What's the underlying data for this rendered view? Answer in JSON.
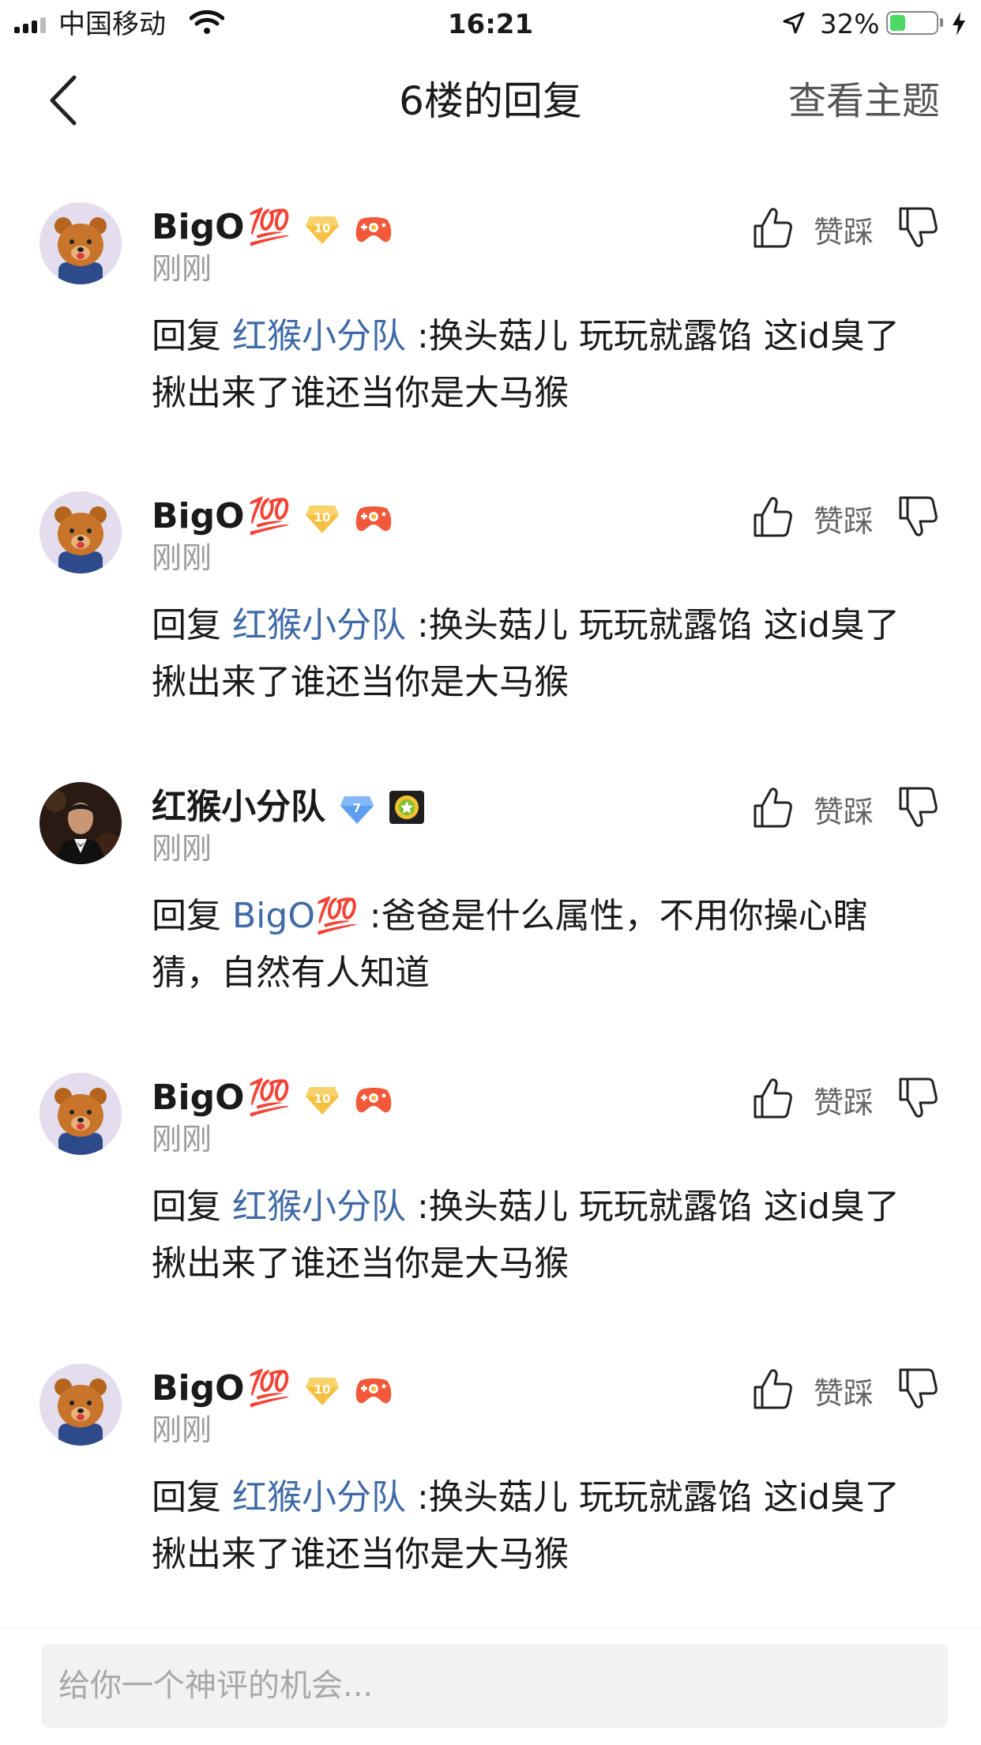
{
  "status_bar": {
    "carrier": "中国移动",
    "time": "16:21",
    "battery_percent": "32%",
    "battery_level": 0.32,
    "battery_color": "#4cd964"
  },
  "nav": {
    "title": "6楼的回复",
    "right_action": "查看主题",
    "back_icon": "chevron-left-icon"
  },
  "colors": {
    "mention": "#3f6aa6",
    "timestamp": "#9b9b9b"
  },
  "replies": [
    {
      "author": "BigO",
      "author_emoji": "💯",
      "level_badge": "10",
      "avatar": "bear-avatar",
      "time": "刚刚",
      "zancai_label": "赞踩",
      "prefix": "回复 ",
      "mention": "红猴小分队",
      "text_line1": " :换头菇儿 玩玩就露馅 这id臭了",
      "text_line2": "揪出来了谁还当你是大马猴"
    },
    {
      "author": "BigO",
      "author_emoji": "💯",
      "level_badge": "10",
      "avatar": "bear-avatar",
      "time": "刚刚",
      "zancai_label": "赞踩",
      "prefix": "回复 ",
      "mention": "红猴小分队",
      "text_line1": " :换头菇儿 玩玩就露馅 这id臭了",
      "text_line2": "揪出来了谁还当你是大马猴"
    },
    {
      "author": "红猴小分队",
      "author_emoji": "",
      "level_badge": "7",
      "avatar": "man-in-suit-avatar",
      "time": "刚刚",
      "zancai_label": "赞踩",
      "prefix": "回复 ",
      "mention": "BigO💯",
      "text_line1": " :爸爸是什么属性，不用你操心瞎",
      "text_line2": "猜，自然有人知道"
    },
    {
      "author": "BigO",
      "author_emoji": "💯",
      "level_badge": "10",
      "avatar": "bear-avatar",
      "time": "刚刚",
      "zancai_label": "赞踩",
      "prefix": "回复 ",
      "mention": "红猴小分队",
      "text_line1": " :换头菇儿 玩玩就露馅 这id臭了",
      "text_line2": "揪出来了谁还当你是大马猴"
    },
    {
      "author": "BigO",
      "author_emoji": "💯",
      "level_badge": "10",
      "avatar": "bear-avatar",
      "time": "刚刚",
      "zancai_label": "赞踩",
      "prefix": "回复 ",
      "mention": "红猴小分队",
      "text_line1": " :换头菇儿 玩玩就露馅 这id臭了",
      "text_line2": "揪出来了谁还当你是大马猴"
    }
  ],
  "comment_box": {
    "placeholder": "给你一个神评的机会..."
  }
}
